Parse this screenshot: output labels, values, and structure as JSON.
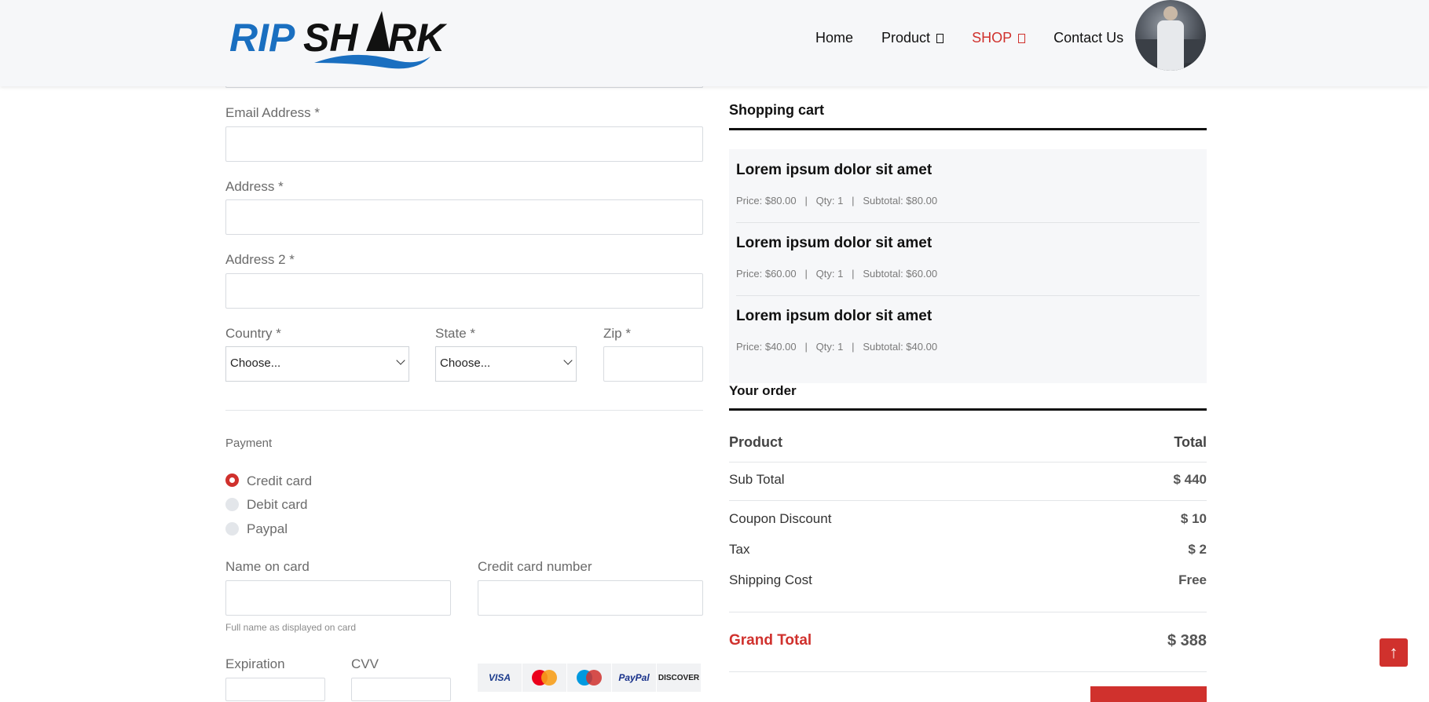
{
  "header": {
    "logo_text": "RIPSHARK",
    "nav": [
      {
        "label": "Home",
        "has_dropdown": false
      },
      {
        "label": "Product",
        "has_dropdown": true
      },
      {
        "label": "SHOP",
        "has_dropdown": true,
        "active": true
      },
      {
        "label": "Contact Us",
        "has_dropdown": false
      }
    ]
  },
  "form": {
    "email_label": "Email Address *",
    "address_label": "Address *",
    "address2_label": "Address 2 *",
    "country_label": "Country *",
    "country_value": "Choose...",
    "state_label": "State *",
    "state_value": "Choose...",
    "zip_label": "Zip *",
    "payment_title": "Payment",
    "payment_options": [
      "Credit card",
      "Debit card",
      "Paypal"
    ],
    "payment_selected": "Credit card",
    "name_on_card_label": "Name on card",
    "name_hint": "Full name as displayed on card",
    "cc_number_label": "Credit card number",
    "expiration_label": "Expiration",
    "cvv_label": "CVV",
    "card_brands": [
      "VISA",
      "MasterCard",
      "Maestro",
      "PayPal",
      "DISCOVER"
    ]
  },
  "cart": {
    "title": "Shopping cart",
    "items": [
      {
        "name": "Lorem ipsum dolor sit amet",
        "meta": "Price: $80.00   |   Qty: 1   |   Subtotal: $80.00"
      },
      {
        "name": "Lorem ipsum dolor sit amet",
        "meta": "Price: $60.00   |   Qty: 1   |   Subtotal: $60.00"
      },
      {
        "name": "Lorem ipsum dolor sit amet",
        "meta": "Price: $40.00   |   Qty: 1   |   Subtotal: $40.00"
      }
    ]
  },
  "order": {
    "title": "Your order",
    "head_left": "Product",
    "head_right": "Total",
    "subtotal_label": "Sub Total",
    "subtotal_value": "$ 440",
    "coupon_label": "Coupon Discount",
    "coupon_value": "$ 10",
    "tax_label": "Tax",
    "tax_value": "$ 2",
    "shipping_label": "Shipping Cost",
    "shipping_value": "Free",
    "grand_label": "Grand Total",
    "grand_value": "$ 388"
  },
  "colors": {
    "accent": "#d0312d",
    "brand_blue": "#1a6fc0"
  }
}
